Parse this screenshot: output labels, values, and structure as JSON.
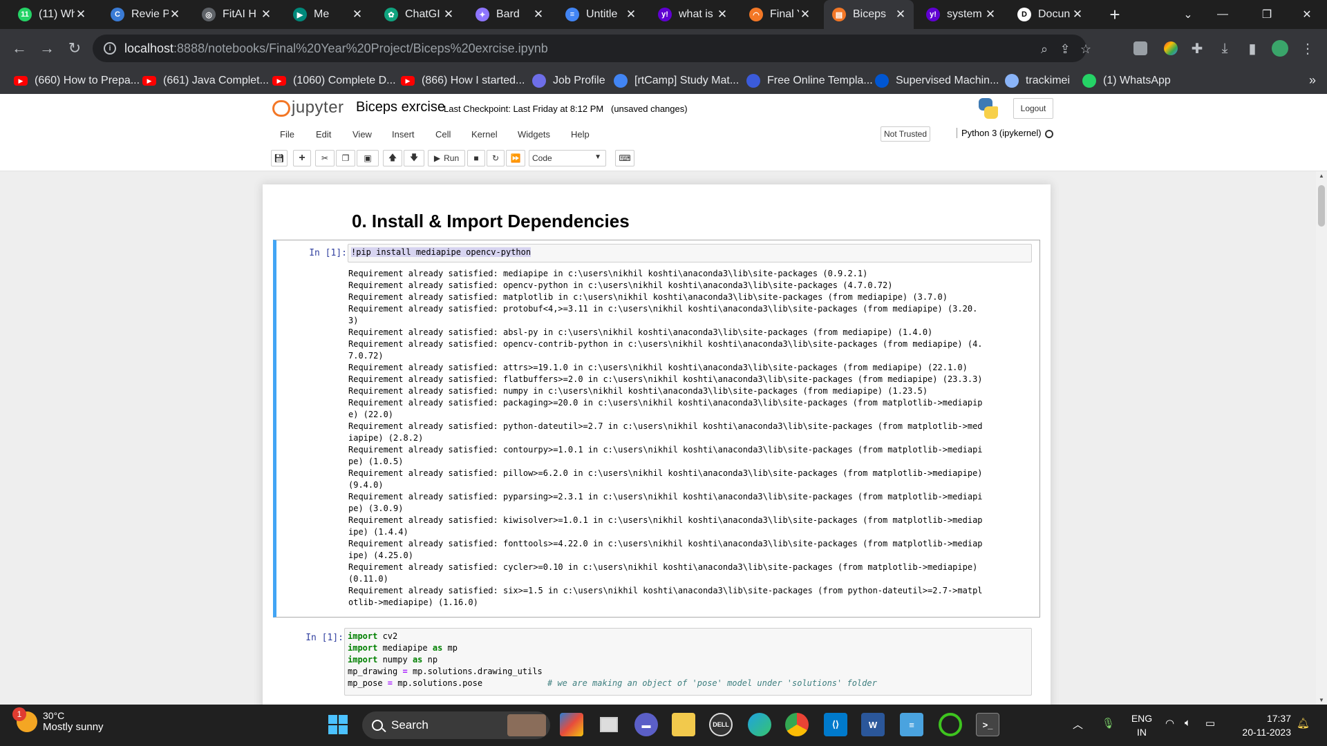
{
  "browser": {
    "tabs": [
      {
        "title": "(11) Wh",
        "icon": "whatsapp-icon",
        "color": "#25d366",
        "glyph": "11"
      },
      {
        "title": "Revie P",
        "icon": "revie-icon",
        "color": "#3a7bd5",
        "glyph": "C"
      },
      {
        "title": "FitAI H",
        "icon": "globe-icon",
        "color": "#5f6368",
        "glyph": "◎"
      },
      {
        "title": "Me",
        "icon": "meet-icon",
        "color": "#00897b",
        "glyph": "▶"
      },
      {
        "title": "ChatGI",
        "icon": "chatgpt-icon",
        "color": "#10a37f",
        "glyph": "✿"
      },
      {
        "title": "Bard",
        "icon": "bard-icon",
        "color": "#8e75ff",
        "glyph": "✦"
      },
      {
        "title": "Untitle",
        "icon": "docs-icon",
        "color": "#4285f4",
        "glyph": "≡"
      },
      {
        "title": "what is",
        "icon": "yahoo-icon",
        "color": "#6001d2",
        "glyph": "y!"
      },
      {
        "title": "Final Ye",
        "icon": "jupyter-icon",
        "color": "#f37726",
        "glyph": "◠"
      },
      {
        "title": "Biceps",
        "icon": "notebook-icon",
        "color": "#f37726",
        "glyph": "▤"
      },
      {
        "title": "system",
        "icon": "yahoo-icon",
        "color": "#6001d2",
        "glyph": "y!"
      },
      {
        "title": "Docun",
        "icon": "docs-icon",
        "color": "#ffffff",
        "glyph": "D"
      }
    ],
    "active_tab_index": 9,
    "address": {
      "host": "localhost",
      "path": ":8888/notebooks/Final%20Year%20Project/Biceps%20exrcise.ipynb"
    },
    "bookmarks": [
      {
        "label": "(660) How to Prepa...",
        "icon": "youtube-icon"
      },
      {
        "label": "(661) Java Complet...",
        "icon": "youtube-icon"
      },
      {
        "label": "(1060) Complete D...",
        "icon": "youtube-icon"
      },
      {
        "label": "(866) How I started...",
        "icon": "youtube-icon"
      },
      {
        "label": "Job Profile",
        "icon": "link-icon"
      },
      {
        "label": "[rtCamp] Study Mat...",
        "icon": "docs-icon"
      },
      {
        "label": "Free Online Templa...",
        "icon": "globe-icon"
      },
      {
        "label": "Supervised Machin...",
        "icon": "coursera-icon"
      },
      {
        "label": "trackimei",
        "icon": "site-icon"
      },
      {
        "label": "(1) WhatsApp",
        "icon": "whatsapp-icon"
      }
    ],
    "bookmarks_more": "»"
  },
  "jupyter": {
    "logo_text": "jupyter",
    "notebook_name": "Biceps exrcise",
    "checkpoint": "Last Checkpoint: Last Friday at 8:12 PM",
    "unsaved": "(unsaved changes)",
    "logout": "Logout",
    "menu": [
      "File",
      "Edit",
      "View",
      "Insert",
      "Cell",
      "Kernel",
      "Widgets",
      "Help"
    ],
    "not_trusted": "Not Trusted",
    "kernel_name": "Python 3 (ipykernel)",
    "toolbar": {
      "run_label": "Run",
      "cell_type": "Code"
    }
  },
  "notebook": {
    "heading": "0. Install & Import Dependencies",
    "cell1": {
      "prompt": "In [1]:",
      "code": "!pip install mediapipe opencv-python",
      "output": [
        "Requirement already satisfied: mediapipe in c:\\users\\nikhil koshti\\anaconda3\\lib\\site-packages (0.9.2.1)",
        "Requirement already satisfied: opencv-python in c:\\users\\nikhil koshti\\anaconda3\\lib\\site-packages (4.7.0.72)",
        "Requirement already satisfied: matplotlib in c:\\users\\nikhil koshti\\anaconda3\\lib\\site-packages (from mediapipe) (3.7.0)",
        "Requirement already satisfied: protobuf<4,>=3.11 in c:\\users\\nikhil koshti\\anaconda3\\lib\\site-packages (from mediapipe) (3.20.",
        "3)",
        "Requirement already satisfied: absl-py in c:\\users\\nikhil koshti\\anaconda3\\lib\\site-packages (from mediapipe) (1.4.0)",
        "Requirement already satisfied: opencv-contrib-python in c:\\users\\nikhil koshti\\anaconda3\\lib\\site-packages (from mediapipe) (4.",
        "7.0.72)",
        "Requirement already satisfied: attrs>=19.1.0 in c:\\users\\nikhil koshti\\anaconda3\\lib\\site-packages (from mediapipe) (22.1.0)",
        "Requirement already satisfied: flatbuffers>=2.0 in c:\\users\\nikhil koshti\\anaconda3\\lib\\site-packages (from mediapipe) (23.3.3)",
        "Requirement already satisfied: numpy in c:\\users\\nikhil koshti\\anaconda3\\lib\\site-packages (from mediapipe) (1.23.5)",
        "Requirement already satisfied: packaging>=20.0 in c:\\users\\nikhil koshti\\anaconda3\\lib\\site-packages (from matplotlib->mediapip",
        "e) (22.0)",
        "Requirement already satisfied: python-dateutil>=2.7 in c:\\users\\nikhil koshti\\anaconda3\\lib\\site-packages (from matplotlib->med",
        "iapipe) (2.8.2)",
        "Requirement already satisfied: contourpy>=1.0.1 in c:\\users\\nikhil koshti\\anaconda3\\lib\\site-packages (from matplotlib->mediapi",
        "pe) (1.0.5)",
        "Requirement already satisfied: pillow>=6.2.0 in c:\\users\\nikhil koshti\\anaconda3\\lib\\site-packages (from matplotlib->mediapipe)",
        "(9.4.0)",
        "Requirement already satisfied: pyparsing>=2.3.1 in c:\\users\\nikhil koshti\\anaconda3\\lib\\site-packages (from matplotlib->mediapi",
        "pe) (3.0.9)",
        "Requirement already satisfied: kiwisolver>=1.0.1 in c:\\users\\nikhil koshti\\anaconda3\\lib\\site-packages (from matplotlib->mediap",
        "ipe) (1.4.4)",
        "Requirement already satisfied: fonttools>=4.22.0 in c:\\users\\nikhil koshti\\anaconda3\\lib\\site-packages (from matplotlib->mediap",
        "ipe) (4.25.0)",
        "Requirement already satisfied: cycler>=0.10 in c:\\users\\nikhil koshti\\anaconda3\\lib\\site-packages (from matplotlib->mediapipe)",
        "(0.11.0)",
        "Requirement already satisfied: six>=1.5 in c:\\users\\nikhil koshti\\anaconda3\\lib\\site-packages (from python-dateutil>=2.7->matpl",
        "otlib->mediapipe) (1.16.0)"
      ]
    },
    "cell2": {
      "prompt": "In [1]:",
      "line1_kw": "import",
      "line1_rest": " cv2",
      "line2_kw": "import",
      "line2_mid": " mediapipe ",
      "line2_as": "as",
      "line2_rest": " mp",
      "line3_kw": "import",
      "line3_mid": " numpy ",
      "line3_as": "as",
      "line3_rest": " np",
      "line4_a": "mp_drawing ",
      "line4_eq": "=",
      "line4_b": " mp.solutions.drawing_utils",
      "line5_a": "mp_pose ",
      "line5_eq": "=",
      "line5_b": " mp.solutions.pose             ",
      "line5_comment": "# we are making an object of 'pose' model under 'solutions' folder"
    }
  },
  "taskbar": {
    "weather_badge": "1",
    "temperature": "30°C",
    "condition": "Mostly sunny",
    "search": "Search",
    "lang_line1": "ENG",
    "lang_line2": "IN",
    "time": "17:37",
    "date": "20-11-2023"
  }
}
